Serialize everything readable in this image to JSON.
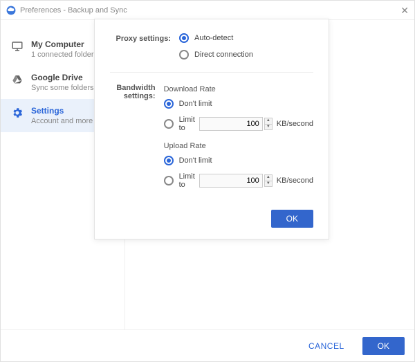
{
  "window": {
    "title": "Preferences - Backup and Sync"
  },
  "sidebar": {
    "items": [
      {
        "title": "My Computer",
        "sub": "1 connected folder"
      },
      {
        "title": "Google Drive",
        "sub": "Sync some folders"
      },
      {
        "title": "Settings",
        "sub": "Account and more"
      }
    ]
  },
  "modal": {
    "proxy_label": "Proxy settings:",
    "proxy_auto": "Auto-detect",
    "proxy_direct": "Direct connection",
    "bandwidth_label": "Bandwidth settings:",
    "download_head": "Download Rate",
    "upload_head": "Upload Rate",
    "dont_limit": "Don't limit",
    "limit_to": "Limit to",
    "download_value": "100",
    "upload_value": "100",
    "unit": "KB/second",
    "ok": "OK"
  },
  "footer": {
    "cancel": "CANCEL",
    "ok": "OK"
  }
}
